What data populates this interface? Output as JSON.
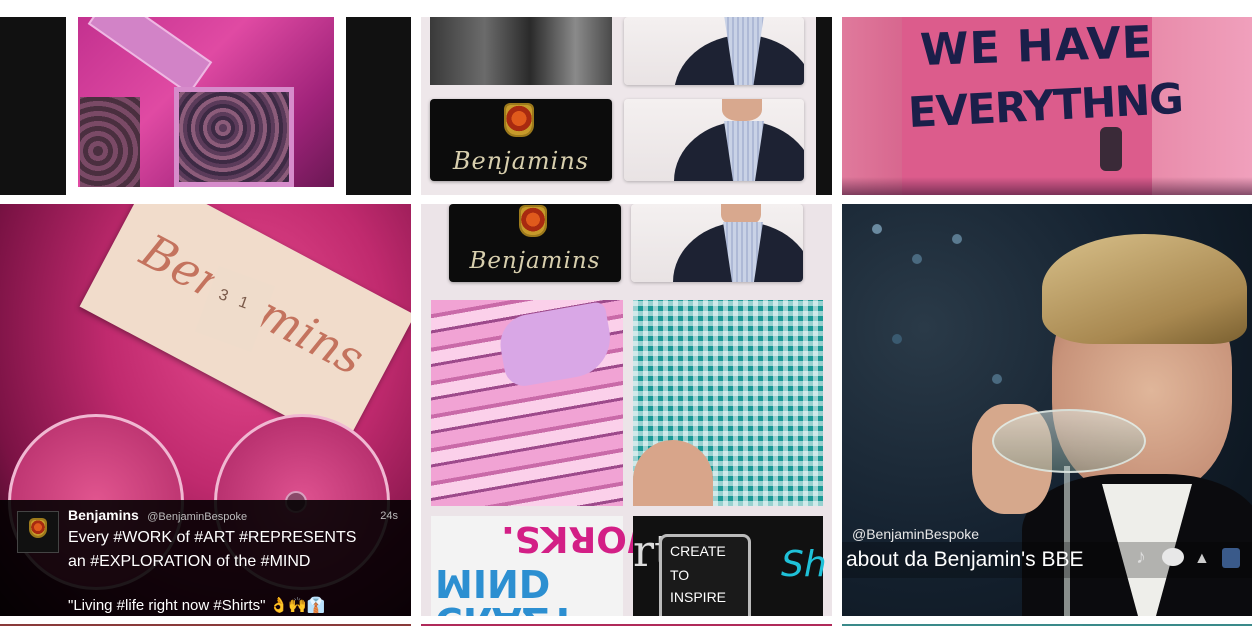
{
  "tiles": {
    "t1": {
      "name": "fabric-pocket-photo"
    },
    "t2": {
      "name": "benjamins-collage-top",
      "logo_text": "Benjamins"
    },
    "t3": {
      "name": "we-have-everything-door",
      "graffiti_line1": "WE HAVE",
      "graffiti_line2": "EVERYTHNG"
    },
    "t4": {
      "name": "shirt-label-tweet",
      "label_brand": "Benjamins",
      "label_size": "3 1",
      "tweet": {
        "author": "Benjamins",
        "handle": "@BenjaminBespoke",
        "time": "24s",
        "line1": "Every #WORK of #ART #REPRESENTS",
        "line2": "an #EXPLORATION of the #MIND",
        "line3": "\"Living #life right now #Shirts\" 👌🙌👔"
      }
    },
    "t5": {
      "name": "benjamins-shirt-collage",
      "logo_text": "Benjamins",
      "crazy_text": "CRAZY MIND",
      "works_text": "WORKS.",
      "create_box": [
        "CREATE",
        "TO",
        "INSPIRE"
      ]
    },
    "t6": {
      "name": "gatsby-toast-tweet",
      "handle": "@BenjaminBespoke",
      "caption": "about da Benjamin's BBE"
    }
  },
  "icons": {
    "verified": "crest-avatar-icon",
    "chat": "speech-bubble-icon",
    "shirt": "shirt-icon"
  },
  "colors": {
    "magenta": "#d1277a",
    "pink_door": "#e06f95",
    "navy": "#1e2440",
    "tweet_text": "#ffffff"
  }
}
